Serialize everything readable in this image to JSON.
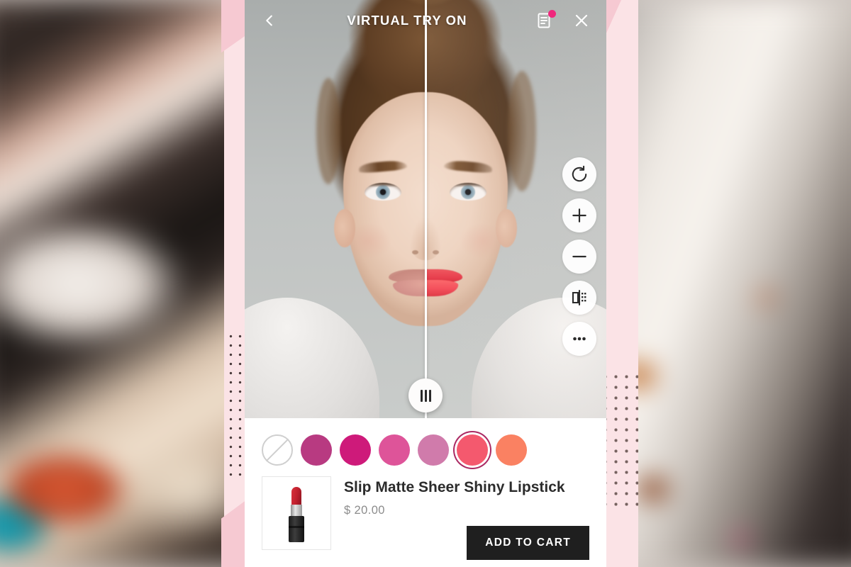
{
  "header": {
    "title": "VIRTUAL TRY ON",
    "back_icon": "chevron-left-icon",
    "list_icon": "document-list-icon",
    "close_icon": "close-icon",
    "badge_color": "#f0277c"
  },
  "viewer": {
    "mode": "before-after-split",
    "split_position_percent": 50,
    "handle_icon": "split-drag-handle-icon",
    "tools": [
      {
        "name": "reset-button",
        "icon": "rotate-ccw-icon"
      },
      {
        "name": "zoom-in-button",
        "icon": "plus-icon"
      },
      {
        "name": "zoom-out-button",
        "icon": "minus-icon"
      },
      {
        "name": "compare-split-button",
        "icon": "compare-mirror-icon"
      },
      {
        "name": "more-options-button",
        "icon": "ellipsis-icon"
      }
    ]
  },
  "shades": {
    "none_label": "No shade",
    "selected_index": 5,
    "items": [
      {
        "label": "None",
        "color": "none"
      },
      {
        "label": "Shade 1",
        "color": "#b83a81"
      },
      {
        "label": "Shade 2",
        "color": "#ce1a7a"
      },
      {
        "label": "Shade 3",
        "color": "#de5499"
      },
      {
        "label": "Shade 4",
        "color": "#d07bab"
      },
      {
        "label": "Shade 5",
        "color": "#f4596e"
      },
      {
        "label": "Shade 6",
        "color": "#fa8162"
      }
    ],
    "selected_ring_color": "#ab2a63"
  },
  "product": {
    "name": "Slip Matte Sheer Shiny Lipstick",
    "price": "$ 20.00",
    "thumb_icon": "lipstick-product-image",
    "cart_label": "ADD TO CART",
    "cart_bg": "#1f1f1f"
  }
}
